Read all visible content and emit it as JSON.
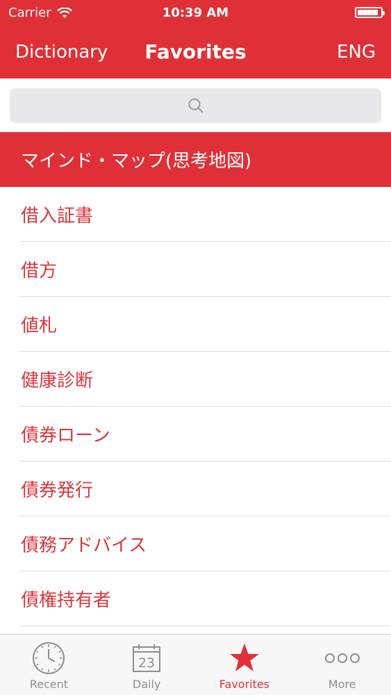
{
  "status_bar": {
    "carrier": "Carrier",
    "time": "10:39 AM",
    "battery_level": 0.8
  },
  "nav": {
    "left": "Dictionary",
    "title": "Favorites",
    "right": "ENG"
  },
  "search": {
    "placeholder": ""
  },
  "list": {
    "items": [
      {
        "label": "マインド・マップ(思考地図)",
        "selected": true
      },
      {
        "label": "借入証書"
      },
      {
        "label": "借方"
      },
      {
        "label": "値札"
      },
      {
        "label": "健康診断"
      },
      {
        "label": "債券ローン"
      },
      {
        "label": "債券発行"
      },
      {
        "label": "債務アドバイス"
      },
      {
        "label": "債権持有者"
      }
    ]
  },
  "tabbar": {
    "tabs": [
      {
        "label": "Recent",
        "icon": "clock-icon"
      },
      {
        "label": "Daily",
        "icon": "calendar-icon",
        "icon_text": "23"
      },
      {
        "label": "Favorites",
        "icon": "star-icon",
        "active": true
      },
      {
        "label": "More",
        "icon": "more-icon"
      }
    ]
  },
  "colors": {
    "accent": "#e03037",
    "inactive": "#8e8e93",
    "search_bg": "#e8e8ea"
  }
}
